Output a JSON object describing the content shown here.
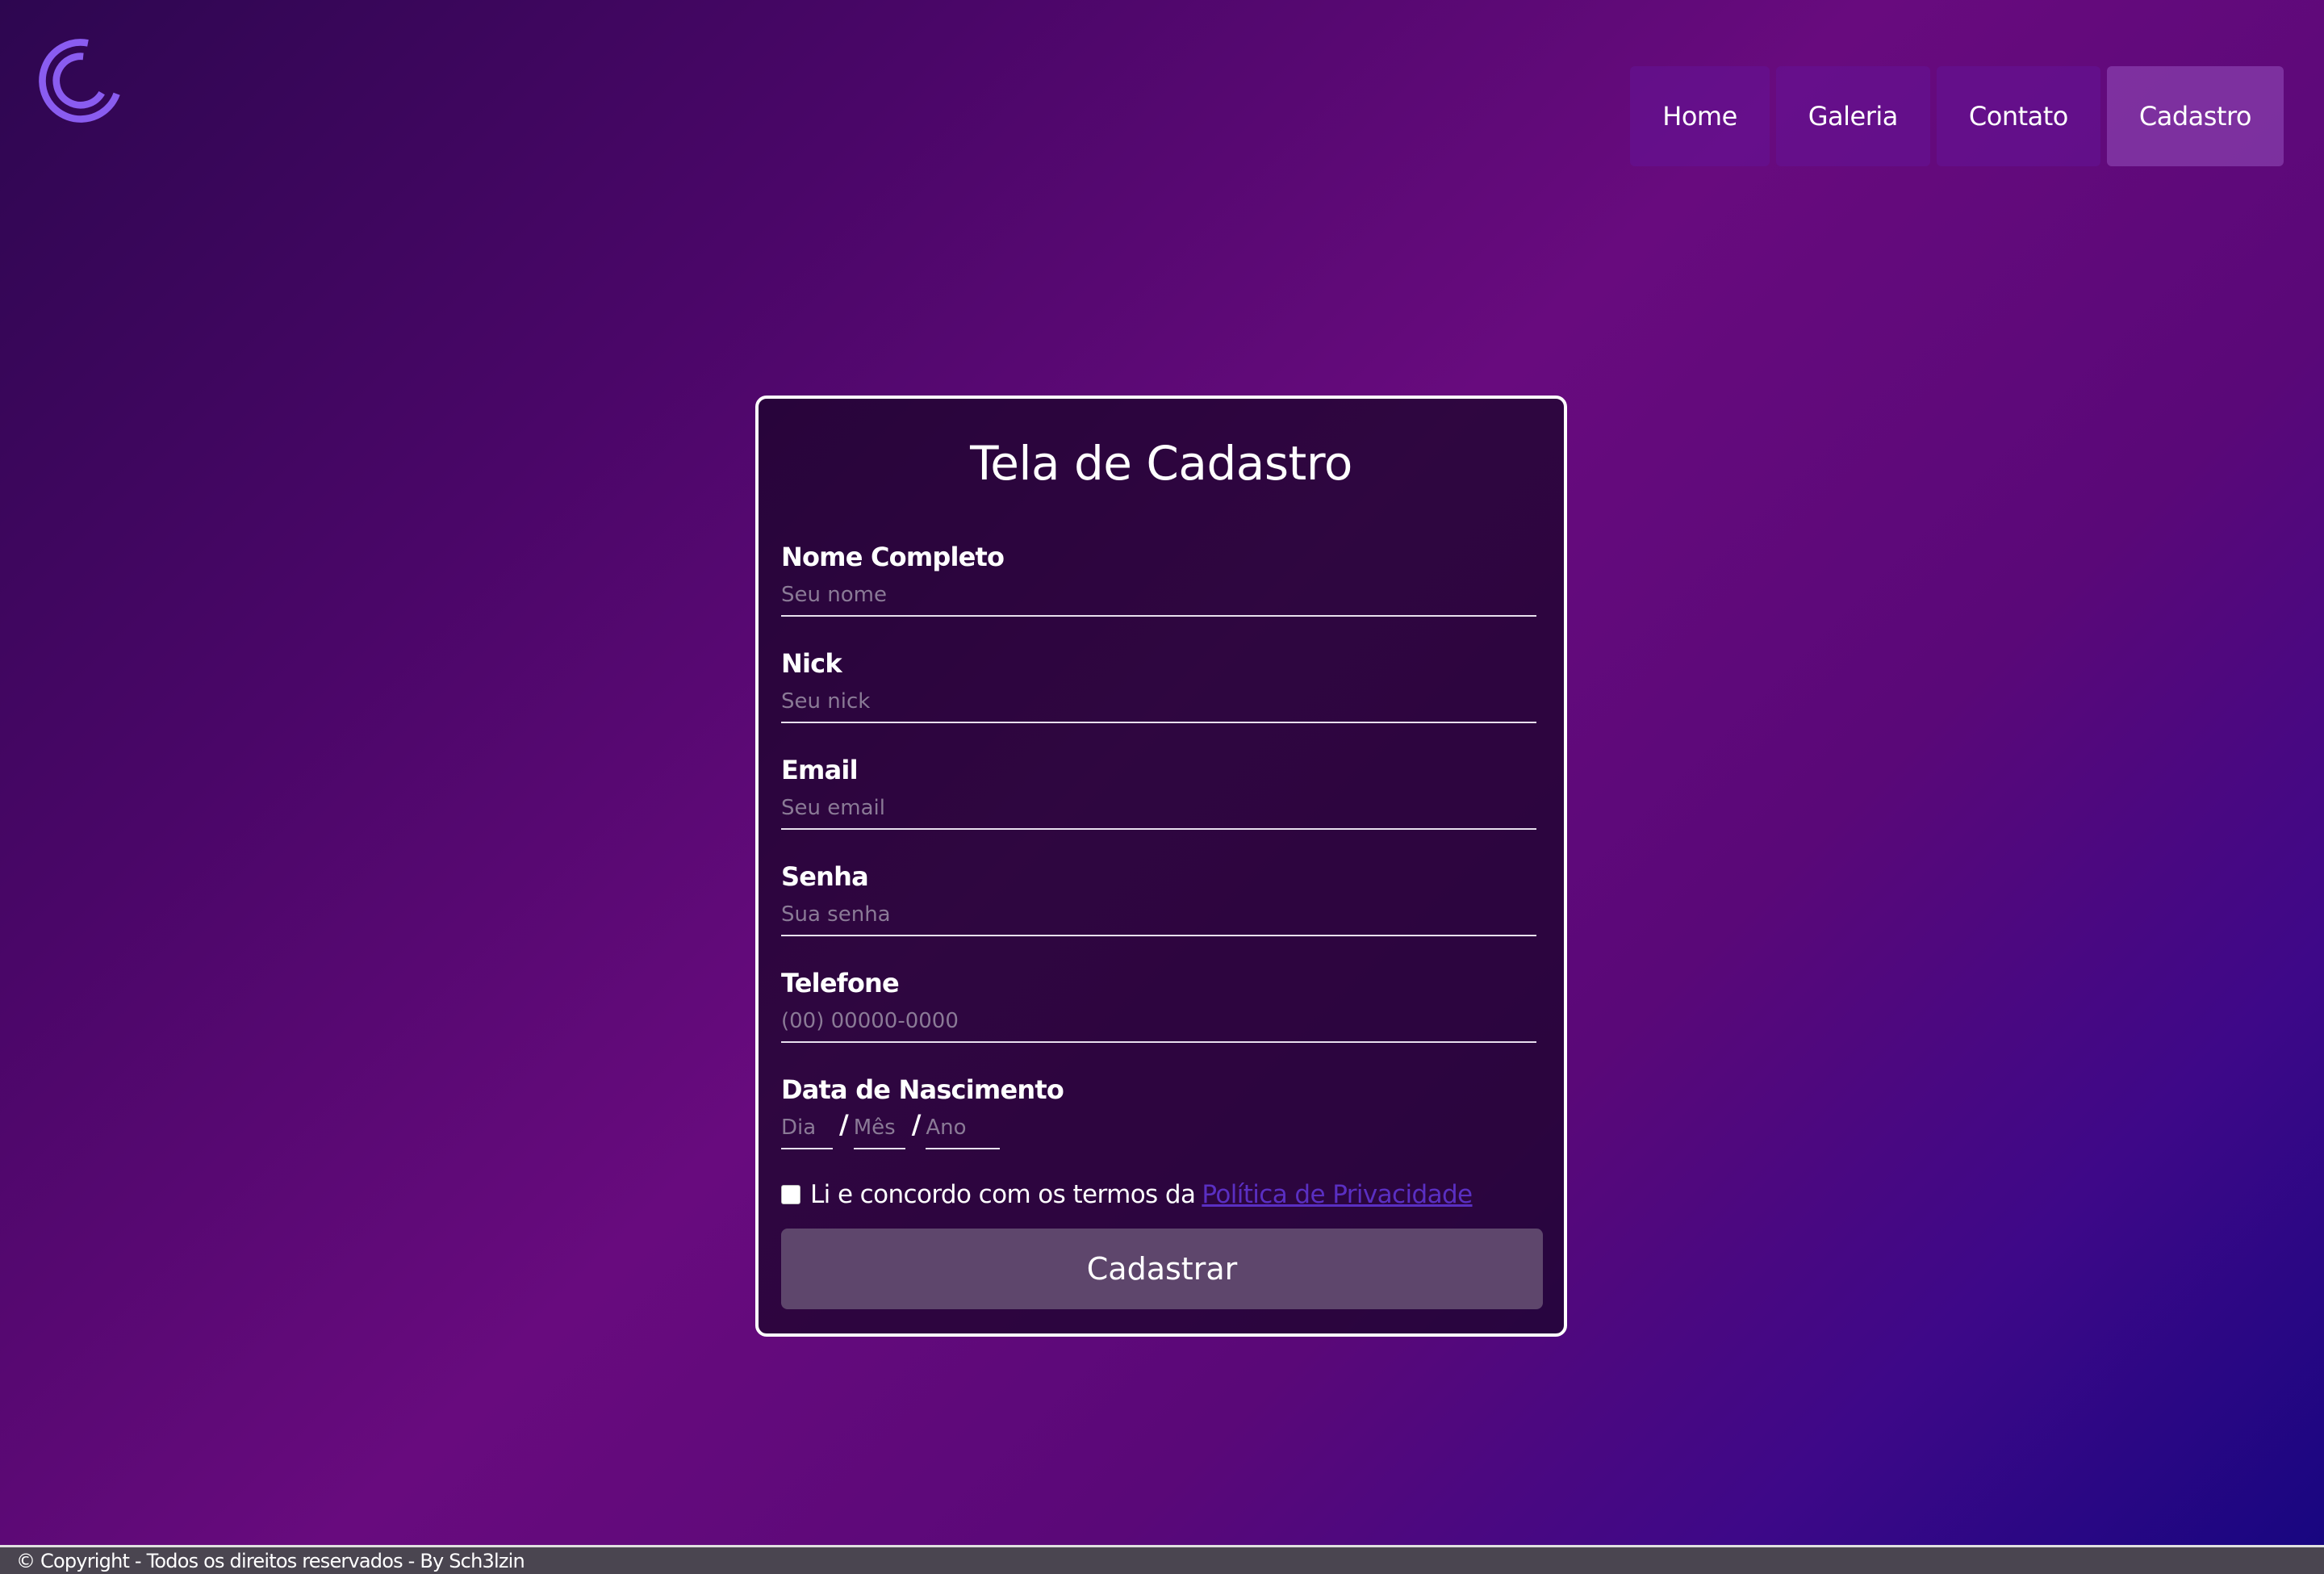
{
  "logo": {
    "icon": "circular-c-logo-icon",
    "color": "#8a5cf0"
  },
  "nav": {
    "items": [
      {
        "label": "Home"
      },
      {
        "label": "Galeria"
      },
      {
        "label": "Contato"
      },
      {
        "label": "Cadastro",
        "active": true
      }
    ]
  },
  "form": {
    "title": "Tela de Cadastro",
    "fields": [
      {
        "label": "Nome Completo",
        "placeholder": "Seu nome",
        "value": ""
      },
      {
        "label": "Nick",
        "placeholder": "Seu nick",
        "value": ""
      },
      {
        "label": "Email",
        "placeholder": "Seu email",
        "value": ""
      },
      {
        "label": "Senha",
        "placeholder": "Sua senha",
        "value": ""
      },
      {
        "label": "Telefone",
        "placeholder": "(00) 00000-0000",
        "value": ""
      }
    ],
    "birthdate": {
      "label": "Data de Nascimento",
      "day_placeholder": "Dia",
      "month_placeholder": "Mês",
      "year_placeholder": "Ano",
      "separator": "/"
    },
    "terms": {
      "text": "Li e concordo com os termos da",
      "link": "Política de Privacidade",
      "checked": false
    },
    "submit_label": "Cadastrar"
  },
  "footer": {
    "text": "© Copyright - Todos os direitos reservados - By Sch3lzin"
  },
  "colors": {
    "accent_link": "#5a2fc2",
    "button_bg": "#5e466c",
    "logo": "#8a5cf0"
  }
}
